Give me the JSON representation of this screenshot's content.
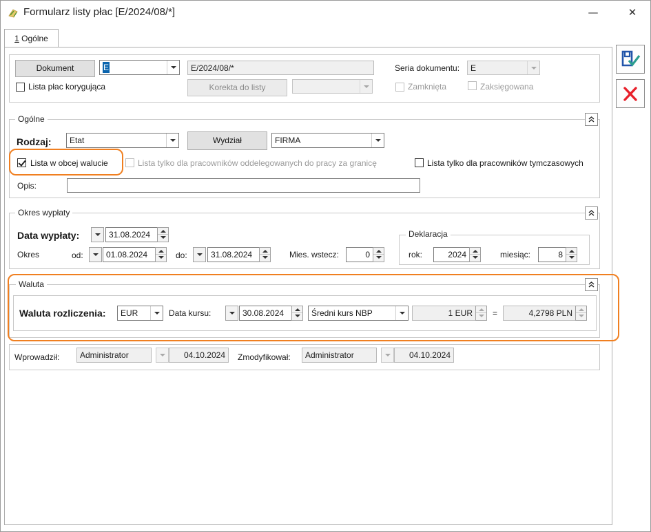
{
  "window": {
    "title": "Formularz listy płac [E/2024/08/*]",
    "minimize_glyph": "—",
    "close_glyph": "✕"
  },
  "tab": {
    "number": "1",
    "label": " Ogólne"
  },
  "header": {
    "dokument_button": "Dokument",
    "doc_symbol_value": "E",
    "doc_number_value": "E/2024/08/*",
    "seria_label": "Seria dokumentu:",
    "seria_value": "E",
    "korygujaca_label": "Lista płac korygująca",
    "korekta_button": "Korekta do listy",
    "zamknieta_label": "Zamknięta",
    "zaksiegowana_label": "Zaksięgowana"
  },
  "ogolne": {
    "legend": "Ogólne",
    "rodzaj_label": "Rodzaj:",
    "rodzaj_value": "Etat",
    "wydzial_button": "Wydział",
    "wydzial_value": "FIRMA",
    "obca_waluta_label": "Lista w obcej walucie",
    "obca_waluta_checked": true,
    "oddelegowani_label": "Lista tylko dla pracowników oddelegowanych do pracy za granicę",
    "tymczasowi_label": "Lista tylko dla pracowników tymczasowych",
    "opis_label": "Opis:",
    "opis_value": ""
  },
  "okres": {
    "legend": "Okres wypłaty",
    "data_wyplaty_label": "Data wypłaty:",
    "data_wyplaty_value": "31.08.2024",
    "okres_label": "Okres",
    "od_label": "od:",
    "od_value": "01.08.2024",
    "do_label": "do:",
    "do_value": "31.08.2024",
    "mies_wstecz_label": "Mies. wstecz:",
    "mies_wstecz_value": "0",
    "deklaracja_legend": "Deklaracja",
    "rok_label": "rok:",
    "rok_value": "2024",
    "miesiac_label": "miesiąc:",
    "miesiac_value": "8"
  },
  "waluta": {
    "legend": "Waluta",
    "rozliczenia_label": "Waluta rozliczenia:",
    "rozliczenia_value": "EUR",
    "data_kursu_label": "Data kursu:",
    "data_kursu_value": "30.08.2024",
    "kurs_type_value": "Średni kurs NBP",
    "amount_value": "1 EUR",
    "equals": "=",
    "rate_value": "4,2798 PLN"
  },
  "audit": {
    "wprowadzil_label": "Wprowadził:",
    "wprowadzil_user": "Administrator",
    "wprowadzil_date": "04.10.2024",
    "zmodyfikowal_label": "Zmodyfikował:",
    "zmodyfikowal_user": "Administrator",
    "zmodyfikowal_date": "04.10.2024"
  },
  "colors": {
    "highlight": "#f07f20",
    "save_icon": "#2255aa",
    "cancel_icon": "#e8202a"
  }
}
